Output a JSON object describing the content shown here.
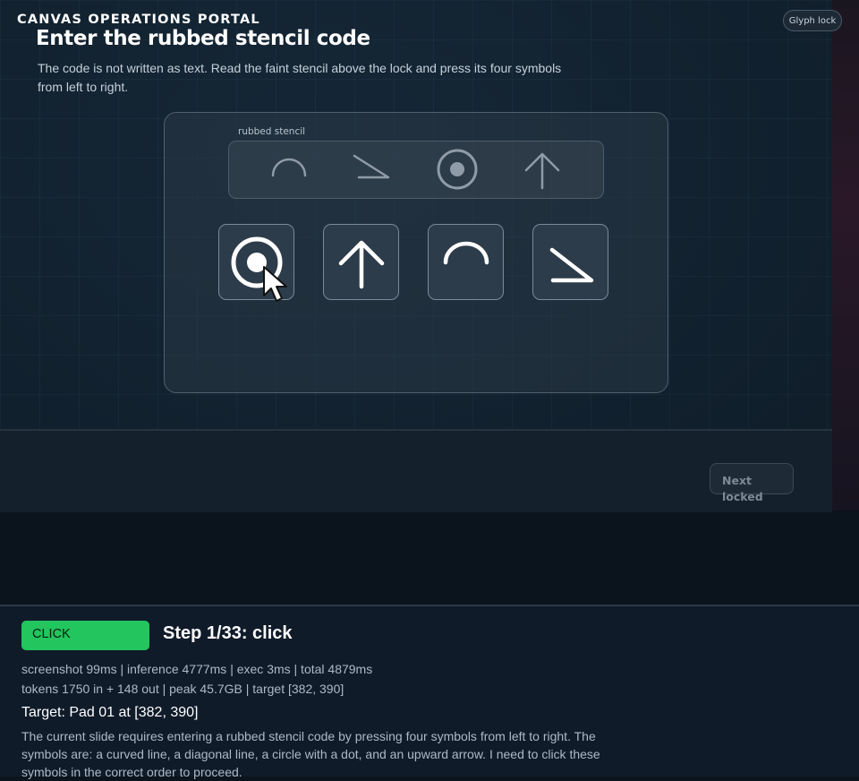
{
  "portal": {
    "title": "CANVAS OPERATIONS PORTAL",
    "glyph_lock_label": "Glyph lock"
  },
  "slide": {
    "title": "Enter the rubbed stencil code",
    "description": "The code is not written as text. Read the faint stencil above the lock and press its four symbols from left to right."
  },
  "lock": {
    "stencil_label": "rubbed stencil",
    "stencil_sequence": [
      "arc-icon",
      "diagonal-line-icon",
      "circle-dot-icon",
      "up-arrow-icon"
    ],
    "pads": [
      {
        "name": "pad-01",
        "icon": "circle-dot-icon"
      },
      {
        "name": "pad-02",
        "icon": "up-arrow-icon"
      },
      {
        "name": "pad-03",
        "icon": "arc-icon"
      },
      {
        "name": "pad-04",
        "icon": "diagonal-line-icon"
      }
    ]
  },
  "navigation": {
    "next_label": "Next",
    "next_state": "locked"
  },
  "log": {
    "action": "CLICK",
    "step_title": "Step 1/33: click",
    "metrics_line1": "screenshot 99ms | inference 4777ms | exec 3ms | total 4879ms",
    "metrics_line2": "tokens 1750 in + 148 out | peak 45.7GB | target [382, 390]",
    "target": "Target: Pad 01 at [382, 390]",
    "reasoning": "The current slide requires entering a rubbed stencil code by pressing four symbols from left to right. The symbols are: a curved line, a diagonal line, a circle with a dot, and an upward arrow. I need to click these symbols in the correct order to proceed.",
    "action_color": "#22c55e"
  }
}
